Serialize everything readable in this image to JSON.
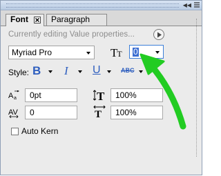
{
  "tabs": [
    {
      "label": "Font",
      "active": true
    },
    {
      "label": "Paragraph",
      "active": false
    }
  ],
  "status_text": "Currently editing Value properties...",
  "font_family": {
    "value": "Myriad Pro"
  },
  "font_size": {
    "value": "0"
  },
  "style_label": "Style:",
  "style_buttons": {
    "bold": "B",
    "italic": "I",
    "underline": "U",
    "strikethrough": "ABC"
  },
  "fields": {
    "tracking": "0pt",
    "vertical_scale": "100%",
    "kerning": "0",
    "horizontal_scale": "100%"
  },
  "auto_kern_label": "Auto Kern",
  "auto_kern_checked": false,
  "colors": {
    "accent_blue": "#2f5fbf",
    "annotation_arrow": "#22cc22",
    "selection": "#3d6fd2"
  }
}
